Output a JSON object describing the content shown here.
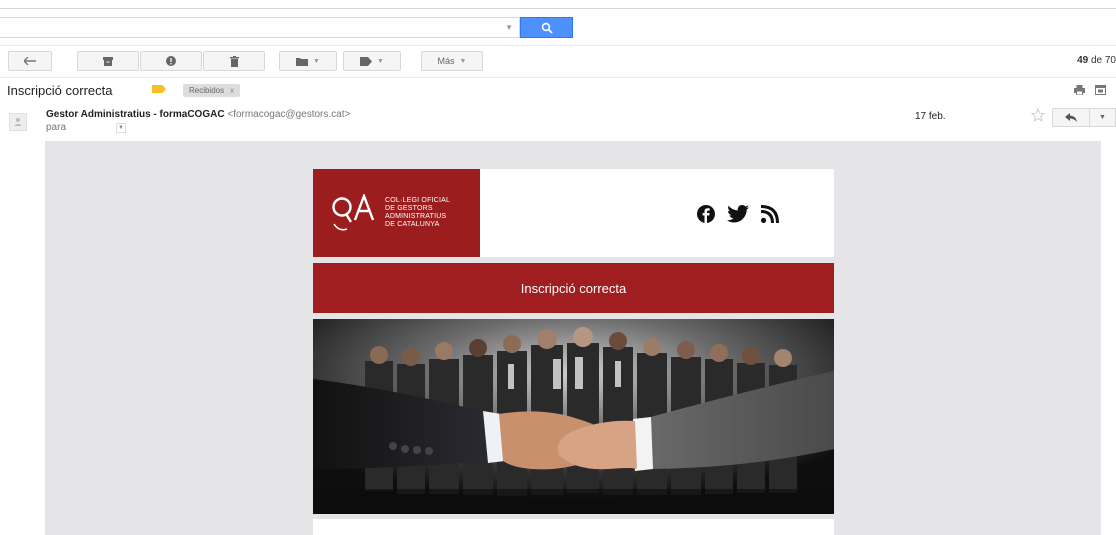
{
  "toolbar": {
    "more_label": "Más",
    "counter_bold": "49",
    "counter_rest": " de 70"
  },
  "message": {
    "subject": "Inscripció correcta",
    "label_chip": "Recibidos",
    "label_chip_close": "x",
    "sender_name": "Gestor Administratius - formaCOGAC",
    "sender_email": "<formacogac@gestors.cat>",
    "to_prefix": "para",
    "date": "17 feb."
  },
  "newsletter": {
    "logo_line1": "COL·LEGI OFICIAL",
    "logo_line2": "DE GESTORS",
    "logo_line3": "ADMINISTRATIUS",
    "logo_line4": "DE CATALUNYA",
    "banner_title": "Inscripció correcta"
  },
  "colors": {
    "search_blue": "#4d90fe",
    "brand_red": "#9c1d1e",
    "label_yellow": "#f6c026",
    "canvas_gray": "#e5e5e8"
  },
  "icons": [
    "search-icon",
    "back-icon",
    "archive-icon",
    "spam-icon",
    "trash-icon",
    "folder-icon",
    "tag-icon",
    "print-icon",
    "new-window-icon",
    "star-icon",
    "reply-icon",
    "facebook-icon",
    "twitter-icon",
    "rss-icon"
  ]
}
